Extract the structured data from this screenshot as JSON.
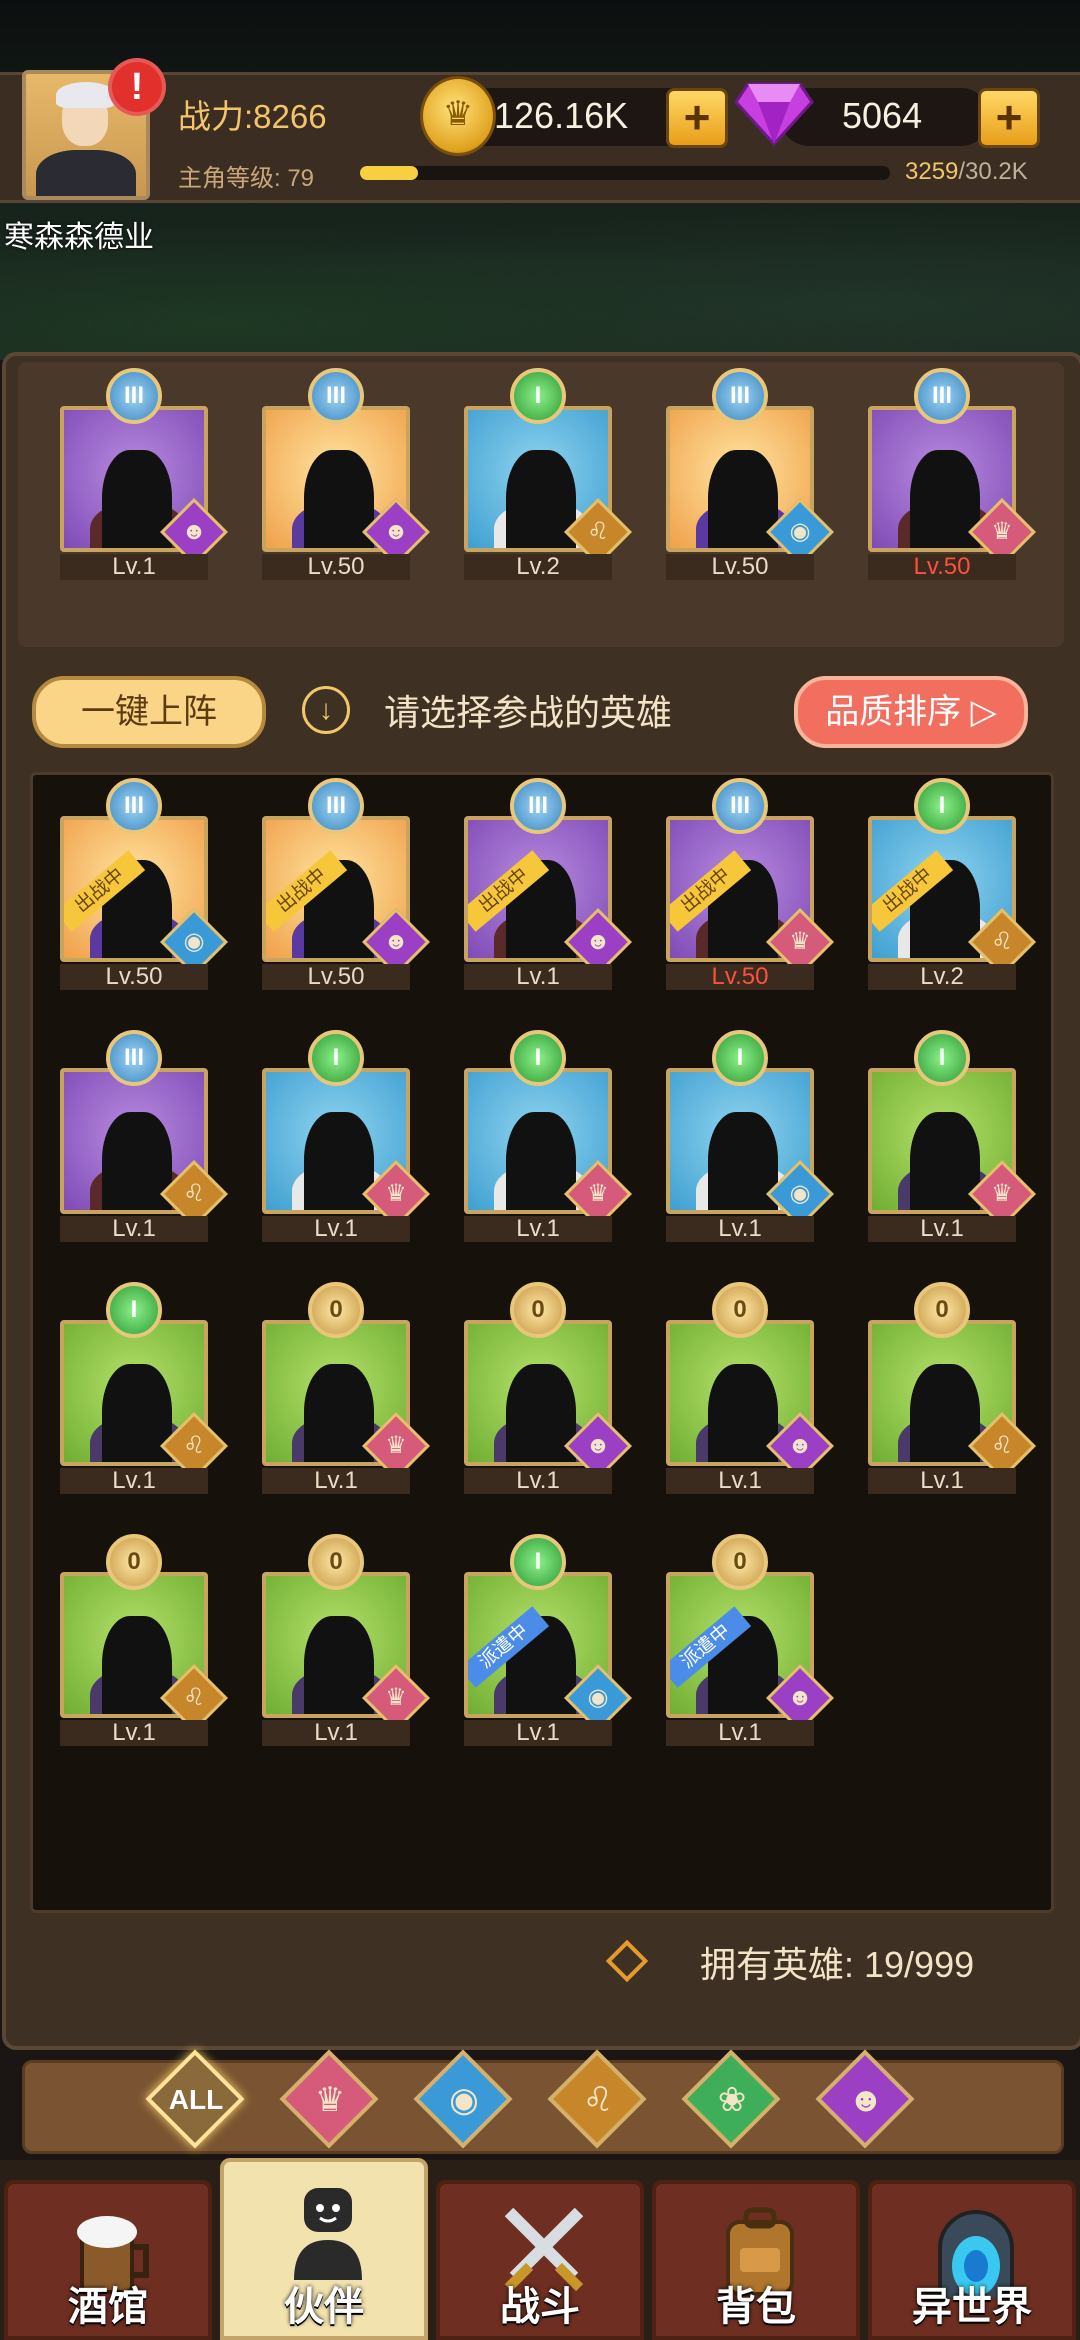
{
  "player": {
    "power": "战力:8266",
    "gold": "126.16K",
    "gems": "5064",
    "level_label": "主角等级: 79",
    "xp_current": "3259",
    "xp_max": "/30.2K",
    "xp_progress": 0.11,
    "name": "寒森森德业",
    "alert_mark": "!"
  },
  "team": [
    {
      "rank": "III",
      "bg": "purple",
      "faction": "demon",
      "level": "Lv.1",
      "red": false
    },
    {
      "rank": "III",
      "bg": "orange",
      "faction": "demon",
      "level": "Lv.50",
      "red": false
    },
    {
      "rank": "I",
      "bg": "blue",
      "faction": "beast",
      "level": "Lv.2",
      "red": false
    },
    {
      "rank": "III",
      "bg": "orange",
      "faction": "fish",
      "level": "Lv.50",
      "red": false
    },
    {
      "rank": "III",
      "bg": "purple",
      "faction": "knight",
      "level": "Lv.50",
      "red": true
    }
  ],
  "actions": {
    "one_key": "一键上阵",
    "hint": "请选择参战的英雄",
    "quality_sort": "品质排序"
  },
  "heroes": [
    {
      "rank": "III",
      "bg": "orange",
      "faction": "fish",
      "level": "Lv.50",
      "red": false,
      "tag": "出战中",
      "tag_color": "gold"
    },
    {
      "rank": "III",
      "bg": "orange",
      "faction": "demon",
      "level": "Lv.50",
      "red": false,
      "tag": "出战中",
      "tag_color": "gold"
    },
    {
      "rank": "III",
      "bg": "purple",
      "faction": "demon",
      "level": "Lv.1",
      "red": false,
      "tag": "出战中",
      "tag_color": "gold"
    },
    {
      "rank": "III",
      "bg": "purple",
      "faction": "knight",
      "level": "Lv.50",
      "red": true,
      "tag": "出战中",
      "tag_color": "gold"
    },
    {
      "rank": "I",
      "bg": "blue",
      "faction": "beast",
      "level": "Lv.2",
      "red": false,
      "tag": "出战中",
      "tag_color": "gold"
    },
    {
      "rank": "III",
      "bg": "purple",
      "faction": "beast",
      "level": "Lv.1",
      "red": false,
      "tag": "",
      "tag_color": ""
    },
    {
      "rank": "I",
      "bg": "blue",
      "faction": "knight",
      "level": "Lv.1",
      "red": false,
      "tag": "",
      "tag_color": ""
    },
    {
      "rank": "I",
      "bg": "blue",
      "faction": "knight",
      "level": "Lv.1",
      "red": false,
      "tag": "",
      "tag_color": ""
    },
    {
      "rank": "I",
      "bg": "blue",
      "faction": "fish",
      "level": "Lv.1",
      "red": false,
      "tag": "",
      "tag_color": ""
    },
    {
      "rank": "I",
      "bg": "green",
      "faction": "knight",
      "level": "Lv.1",
      "red": false,
      "tag": "",
      "tag_color": ""
    },
    {
      "rank": "I",
      "bg": "green",
      "faction": "beast",
      "level": "Lv.1",
      "red": false,
      "tag": "",
      "tag_color": ""
    },
    {
      "rank": "0",
      "bg": "green",
      "faction": "knight",
      "level": "Lv.1",
      "red": false,
      "tag": "",
      "tag_color": ""
    },
    {
      "rank": "0",
      "bg": "green",
      "faction": "demon",
      "level": "Lv.1",
      "red": false,
      "tag": "",
      "tag_color": ""
    },
    {
      "rank": "0",
      "bg": "green",
      "faction": "demon",
      "level": "Lv.1",
      "red": false,
      "tag": "",
      "tag_color": ""
    },
    {
      "rank": "0",
      "bg": "green",
      "faction": "beast",
      "level": "Lv.1",
      "red": false,
      "tag": "",
      "tag_color": ""
    },
    {
      "rank": "0",
      "bg": "green",
      "faction": "beast",
      "level": "Lv.1",
      "red": false,
      "tag": "",
      "tag_color": ""
    },
    {
      "rank": "0",
      "bg": "green",
      "faction": "knight",
      "level": "Lv.1",
      "red": false,
      "tag": "",
      "tag_color": ""
    },
    {
      "rank": "I",
      "bg": "green",
      "faction": "fish",
      "level": "Lv.1",
      "red": false,
      "tag": "派遣中",
      "tag_color": "blue"
    },
    {
      "rank": "0",
      "bg": "green",
      "faction": "demon",
      "level": "Lv.1",
      "red": false,
      "tag": "派遣中",
      "tag_color": "blue"
    }
  ],
  "owned": "拥有英雄: 19/999",
  "filters": [
    {
      "label": "ALL",
      "name": "filter-all",
      "color": "#8a6a3a"
    },
    {
      "label": "",
      "name": "filter-knight-icon",
      "color": "#d65a7a"
    },
    {
      "label": "",
      "name": "filter-fish-icon",
      "color": "#3a9ad8"
    },
    {
      "label": "",
      "name": "filter-beast-icon",
      "color": "#c8862a"
    },
    {
      "label": "",
      "name": "filter-elf-icon",
      "color": "#3fae5a"
    },
    {
      "label": "",
      "name": "filter-demon-icon",
      "color": "#9b3fc4"
    }
  ],
  "nav": [
    {
      "label": "酒馆",
      "icon": "beer-mug-icon",
      "active": false
    },
    {
      "label": "伙伴",
      "icon": "partner-icon",
      "active": true
    },
    {
      "label": "战斗",
      "icon": "crossed-swords-icon",
      "active": false
    },
    {
      "label": "背包",
      "icon": "backpack-icon",
      "active": false
    },
    {
      "label": "异世界",
      "icon": "portal-icon",
      "active": false
    }
  ],
  "faction_colors": {
    "demon": "#9b3fc4",
    "beast": "#c8862a",
    "fish": "#3a9ad8",
    "knight": "#d65a7a"
  },
  "faction_glyphs": {
    "demon": "☻",
    "beast": "♌",
    "fish": "◉",
    "knight": "♛"
  }
}
